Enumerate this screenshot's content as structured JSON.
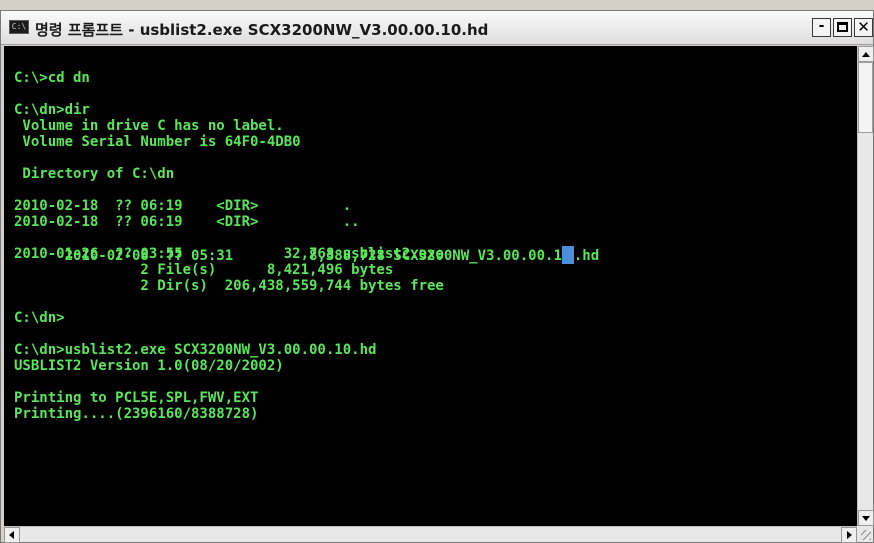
{
  "window": {
    "icon_text": "C:\\",
    "title": "명령 프롬프트 - usblist2.exe SCX3200NW_V3.00.00.10.hd",
    "buttons": {
      "minimize": "-",
      "close": "✕"
    }
  },
  "console": {
    "text_color": "#5ae65a",
    "background": "#000000",
    "selection_color": "#4a8fd9",
    "lines": [
      "C:\\>cd dn",
      "C:\\dn>dir",
      " Volume in drive C has no label.",
      " Volume Serial Number is 64F0-4DB0",
      " Directory of C:\\dn",
      "2010-02-18  ?? 06:19    <DIR>          .",
      "2010-02-18  ?? 06:19    <DIR>          ..",
      "2010-02-08  ?? 05:31         8,388,728 SCX3200NW_V3.00.00.1",
      ".hd",
      "2010-01-26  ?? 03:55            32,768 usblist2.exe",
      "               2 File(s)      8,421,496 bytes",
      "               2 Dir(s)  206,438,559,744 bytes free",
      "C:\\dn>",
      "C:\\dn>usblist2.exe SCX3200NW_V3.00.00.10.hd",
      "USBLIST2 Version 1.0(08/20/2002)",
      "Printing to PCL5E,SPL,FWV,EXT",
      "Printing....(2396160/8388728)"
    ]
  }
}
